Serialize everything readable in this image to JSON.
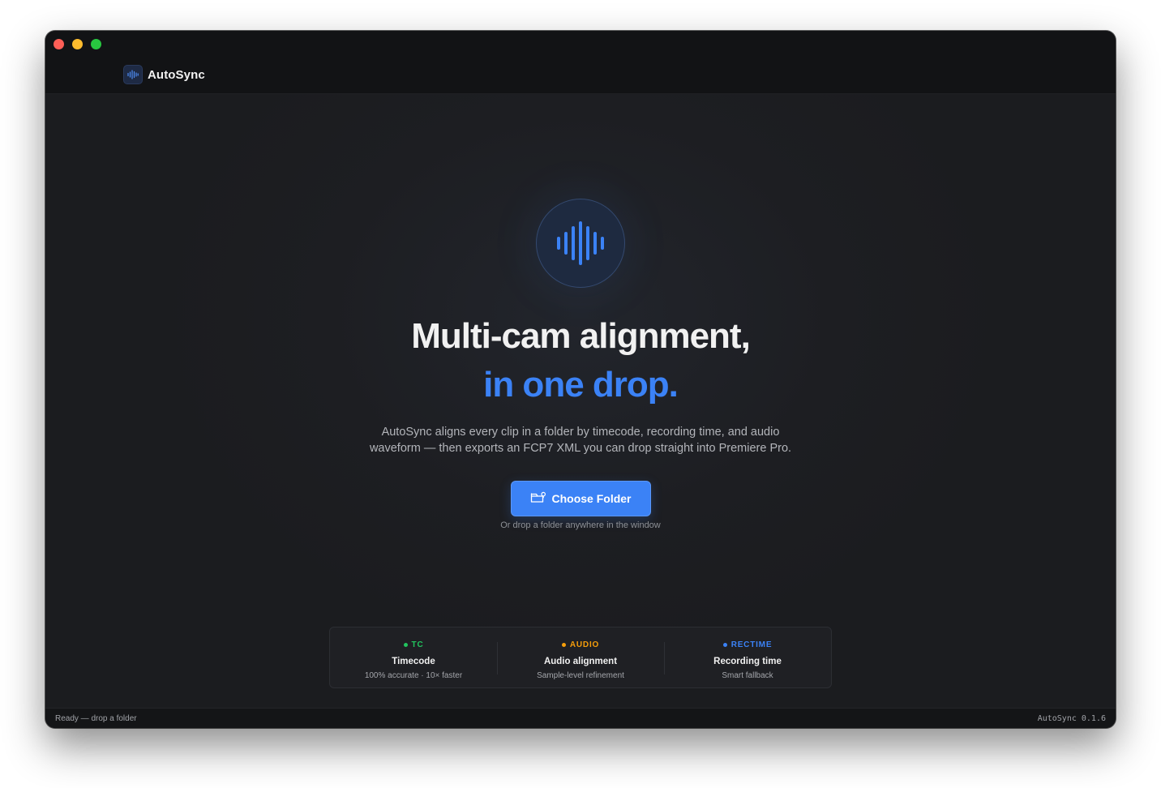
{
  "app": {
    "name": "AutoSync"
  },
  "colors": {
    "accent": "#3b82f6",
    "tc": "#22c55e",
    "audio": "#f59e0b",
    "rectime": "#3b82f6"
  },
  "hero": {
    "icon": "waveform-icon",
    "headline_line1": "Multi-cam alignment,",
    "headline_line2": "in one drop.",
    "subtitle": "AutoSync aligns every clip in a folder by timecode, recording time, and audio waveform — then exports an FCP7 XML you can drop straight into Premiere Pro.",
    "cta_label": "Choose Folder",
    "cta_icon": "folder-icon",
    "cta_hint": "Or drop a folder anywhere in the window"
  },
  "features": [
    {
      "tag": "TC",
      "title": "Timecode",
      "subtitle": "100% accurate · 10× faster"
    },
    {
      "tag": "AUDIO",
      "title": "Audio alignment",
      "subtitle": "Sample-level refinement"
    },
    {
      "tag": "RECTIME",
      "title": "Recording time",
      "subtitle": "Smart fallback"
    }
  ],
  "status": {
    "left": "Ready — drop a folder",
    "right": "AutoSync 0.1.6"
  }
}
